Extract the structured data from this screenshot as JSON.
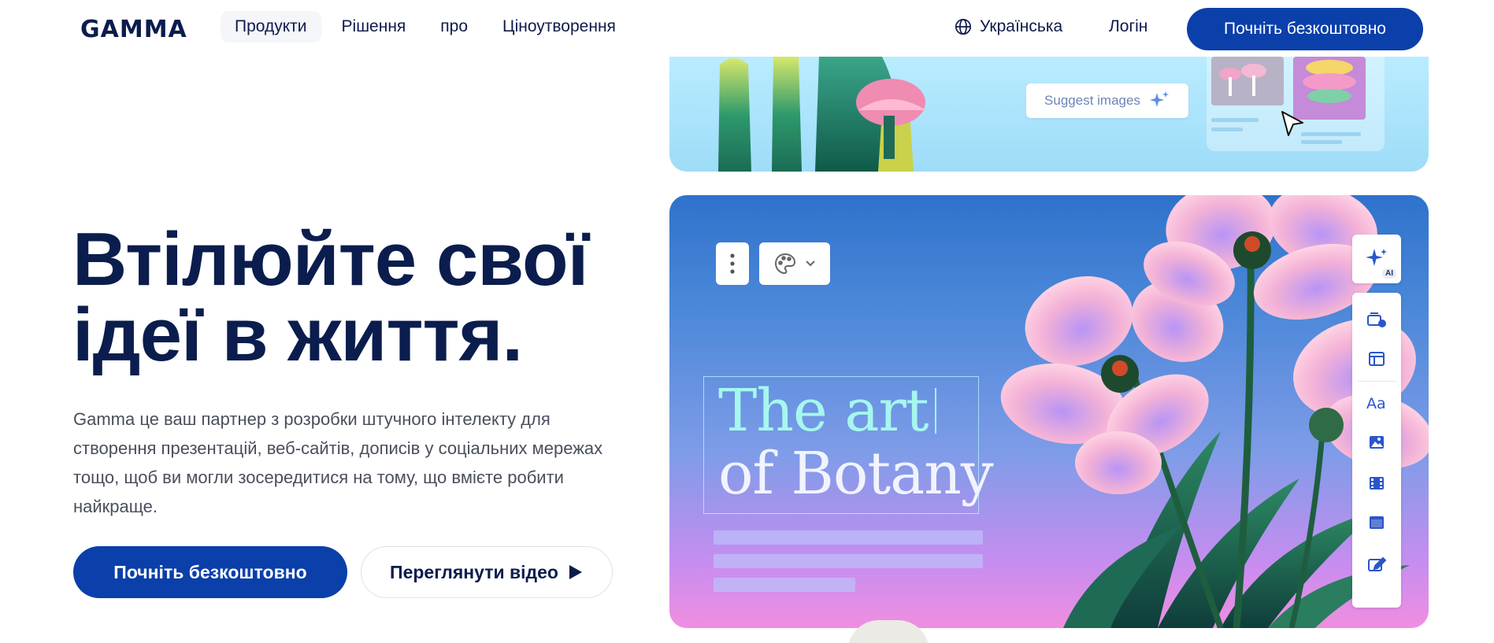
{
  "nav": {
    "logo": "GAMMA",
    "links": [
      "Продукти",
      "Рішення",
      "про",
      "Ціноутворення"
    ],
    "language": "Українська",
    "login": "Логін",
    "cta": "Почніть безкоштовно",
    "globe_icon": "globe-icon"
  },
  "hero": {
    "title_line1": "Втілюйте свої",
    "title_line2": "ідеї в життя.",
    "description": "Gamma це ваш партнер з розробки штучного інтелекту для створення презентацій, веб-сайтів, дописів у соціальних мережах тощо, щоб ви могли зосередитися на тому, що вмієте робити найкраще.",
    "cta_primary": "Почніть безкоштовно",
    "cta_secondary": "Переглянути відео",
    "play_icon": "play-icon"
  },
  "demo": {
    "suggest_label": "Suggest images",
    "art_line1": "The art",
    "art_line2": "of Botany",
    "ai_label": "AI",
    "sidebar_icons": [
      "add-card-icon",
      "layout-icon",
      "text-style-icon",
      "image-icon",
      "video-icon",
      "embed-icon",
      "edit-icon"
    ]
  },
  "colors": {
    "brand": "#0b3faa",
    "heading": "#0b1d4d",
    "body_text": "#4a4f5c"
  }
}
